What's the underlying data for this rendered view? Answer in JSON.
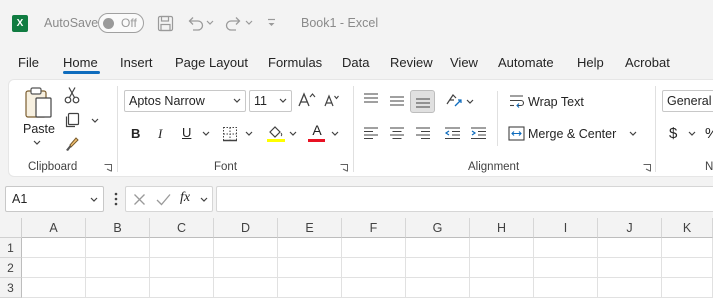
{
  "titlebar": {
    "app_icon": "excel-logo",
    "app_letter": "X",
    "autosave_label": "AutoSave",
    "autosave_state": "Off",
    "document_title": "Book1 - Excel"
  },
  "tabs": [
    "File",
    "Home",
    "Insert",
    "Page Layout",
    "Formulas",
    "Data",
    "Review",
    "View",
    "Automate",
    "Help",
    "Acrobat"
  ],
  "active_tab": "Home",
  "ribbon": {
    "clipboard": {
      "paste_label": "Paste",
      "group_label": "Clipboard"
    },
    "font": {
      "font_name": "Aptos Narrow",
      "font_size": "11",
      "bold": "B",
      "italic": "I",
      "underline": "U",
      "font_color_letter": "A",
      "group_label": "Font",
      "fill_color": "#ffff00",
      "font_color": "#e81123"
    },
    "alignment": {
      "wrap_text": "Wrap Text",
      "merge_center": "Merge & Center",
      "group_label": "Alignment"
    },
    "number": {
      "format": "General",
      "currency_symbol": "$",
      "percent_symbol": "%",
      "group_label": "N"
    }
  },
  "formula_bar": {
    "name_box": "A1",
    "fx_label": "fx",
    "formula_value": ""
  },
  "grid": {
    "columns": [
      "A",
      "B",
      "C",
      "D",
      "E",
      "F",
      "G",
      "H",
      "I",
      "J",
      "K"
    ],
    "rows": [
      "1",
      "2",
      "3"
    ],
    "selected_cell": "A1"
  },
  "colors": {
    "accent": "#0f6cbd",
    "excel_green": "#107c41"
  }
}
